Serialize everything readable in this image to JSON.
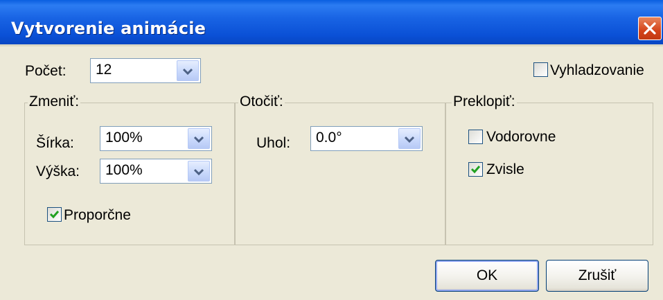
{
  "window": {
    "title": "Vytvorenie animácie"
  },
  "count": {
    "label": "Počet:",
    "value": "12"
  },
  "smoothing": {
    "label": "Vyhladzovanie",
    "checked": false
  },
  "resize": {
    "title": "Zmeniť:",
    "width_label": "Šírka:",
    "width_value": "100%",
    "height_label": "Výška:",
    "height_value": "100%",
    "proportional_label": "Proporčne",
    "proportional_checked": true
  },
  "rotate": {
    "title": "Otočiť:",
    "angle_label": "Uhol:",
    "angle_value": "0.0°"
  },
  "flip": {
    "title": "Preklopiť:",
    "horizontal_label": "Vodorovne",
    "horizontal_checked": false,
    "vertical_label": "Zvisle",
    "vertical_checked": true
  },
  "buttons": {
    "ok_label": "OK",
    "cancel_label": "Zrušiť"
  },
  "icons": {
    "close": "close-icon",
    "dropdown": "chevron-down-icon",
    "check": "check-icon"
  },
  "colors": {
    "titlebar": "#0a50d6",
    "close_button": "#d4441a",
    "dialog_bg": "#ece9d8",
    "check_mark": "#21a121"
  }
}
